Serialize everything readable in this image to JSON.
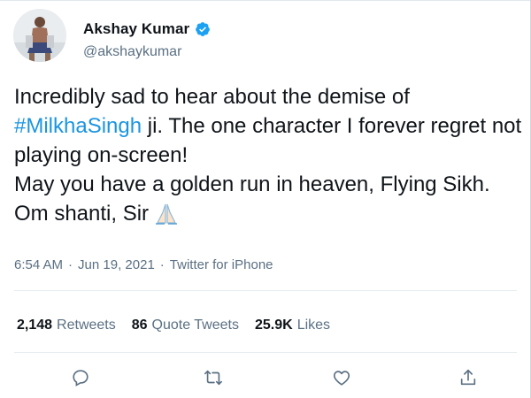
{
  "tweet": {
    "author_name": "Akshay Kumar",
    "author_handle": "@akshaykumar",
    "text_line1": "Incredibly sad to hear about the demise of",
    "hashtag": "#MilkhaSingh",
    "text_line2_rest": " ji. The one character I forever regret not playing on-screen!",
    "text_line3": "May you have a golden run in heaven, Flying Sikh. Om shanti, Sir",
    "emoji_icon": "folded-hands-icon",
    "time": "6:54 AM",
    "date": "Jun 19, 2021",
    "source": "Twitter for iPhone",
    "separator": "·"
  },
  "stats": {
    "retweets_count": "2,148",
    "retweets_label": "Retweets",
    "quotes_count": "86",
    "quotes_label": "Quote Tweets",
    "likes_count": "25.9K",
    "likes_label": "Likes"
  },
  "actions": [
    "reply-icon",
    "retweet-icon",
    "like-icon",
    "share-icon"
  ],
  "colors": {
    "hashtag": "#1b95e0",
    "verified": "#1da1f2",
    "muted": "#5b7083"
  }
}
